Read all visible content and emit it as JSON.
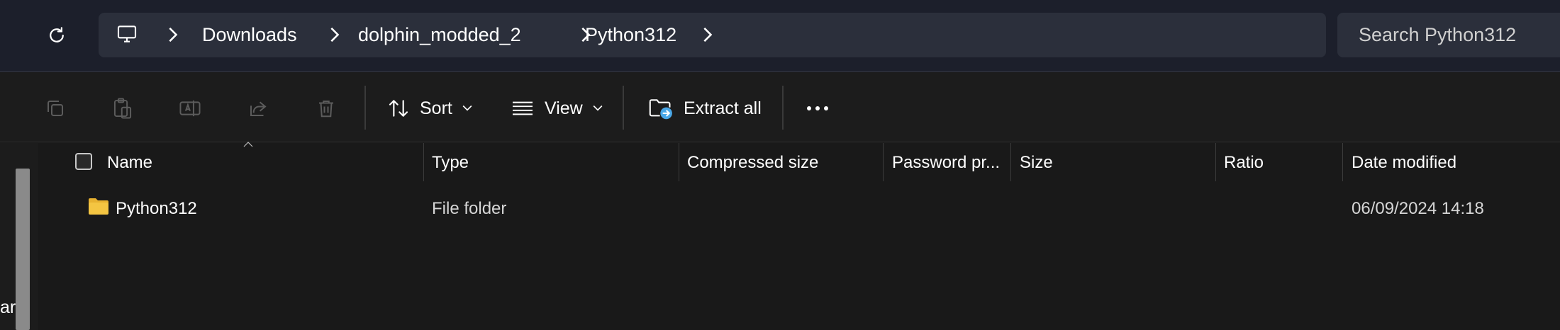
{
  "address_bar": {
    "breadcrumbs": [
      "Downloads",
      "dolphin_modded_2",
      "Python312"
    ],
    "search_placeholder": "Search Python312"
  },
  "command_bar": {
    "sort_label": "Sort",
    "view_label": "View",
    "extract_label": "Extract all"
  },
  "left_pane": {
    "clipped_text": "ar"
  },
  "columns": [
    "Name",
    "Type",
    "Compressed size",
    "Password pr...",
    "Size",
    "Ratio",
    "Date modified"
  ],
  "rows": [
    {
      "name": "Python312",
      "type": "File folder",
      "compressed_size": "",
      "password": "",
      "size": "",
      "ratio": "",
      "date_modified": "06/09/2024 14:18"
    }
  ],
  "colors": {
    "address_bg": "#1c1f2b",
    "field_bg": "#2b2f3b",
    "command_bg": "#1c1c1c",
    "list_bg": "#191919",
    "folder_yellow": "#f4c542",
    "extract_accent": "#4aa8e8"
  },
  "icons": [
    "refresh-icon",
    "monitor-icon",
    "chevron-right-icon",
    "copy-icon",
    "paste-icon",
    "rename-icon",
    "share-icon",
    "delete-icon",
    "sort-icon",
    "view-icon",
    "extract-icon",
    "more-icon",
    "folder-icon"
  ]
}
